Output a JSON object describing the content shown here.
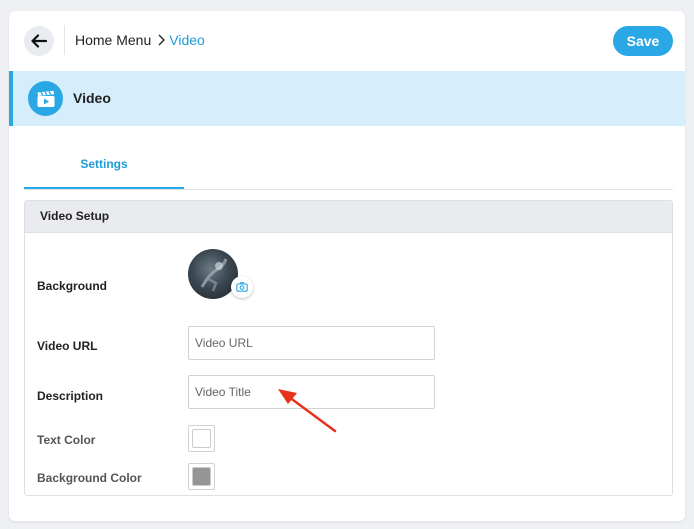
{
  "topbar": {
    "breadcrumb": {
      "home": "Home Menu",
      "current": "Video"
    },
    "save_label": "Save"
  },
  "module": {
    "title": "Video",
    "icon": "video-clapper-icon"
  },
  "tabs": [
    {
      "label": "Settings",
      "active": true
    }
  ],
  "panel": {
    "title": "Video Setup",
    "fields": {
      "background": {
        "label": "Background"
      },
      "video_url": {
        "label": "Video URL",
        "placeholder": "Video URL",
        "value": ""
      },
      "description": {
        "label": "Description",
        "placeholder": "Video Title",
        "value": ""
      },
      "text_color": {
        "label": "Text Color",
        "color": "#ffffff"
      },
      "background_color": {
        "label": "Background Color",
        "color": "#959595"
      }
    }
  },
  "colors": {
    "accent": "#2aa8e6",
    "header_bg": "#d6eefb",
    "annotation": "#e8321c"
  }
}
